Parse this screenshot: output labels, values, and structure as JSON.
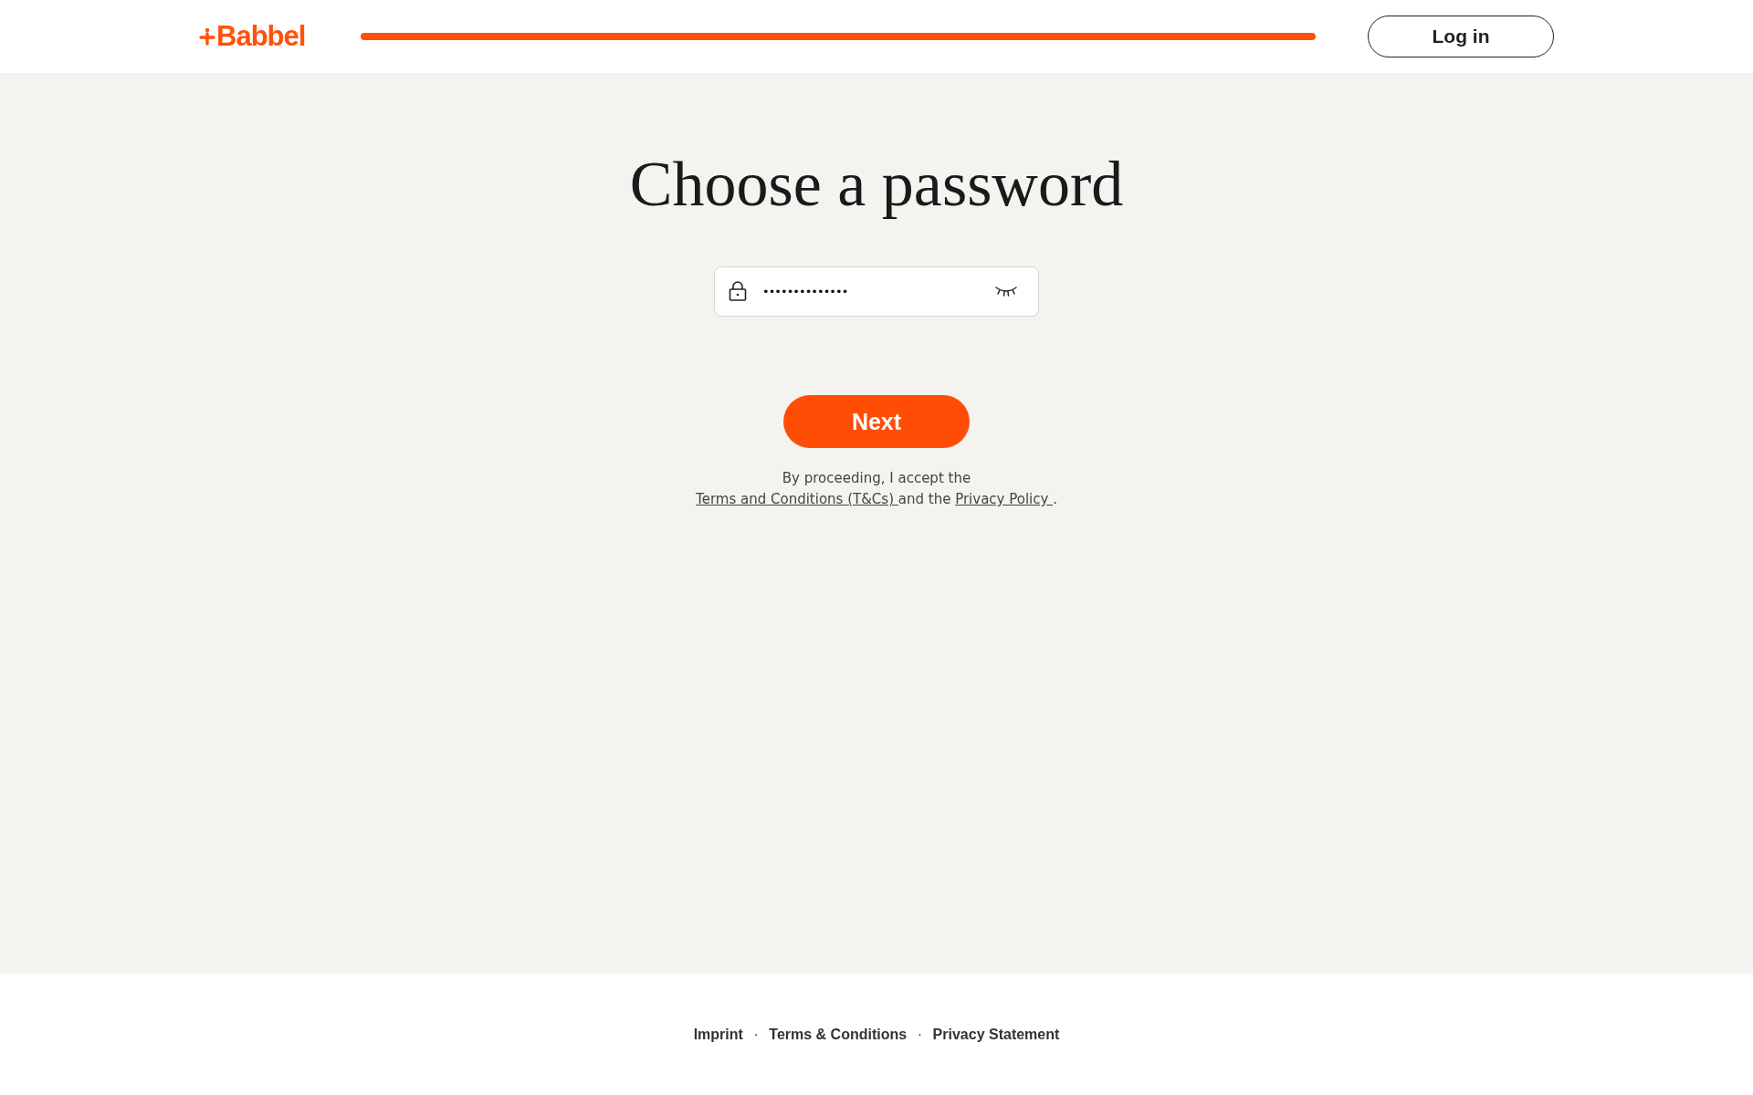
{
  "header": {
    "logo": "Babbel",
    "login_button": "Log in"
  },
  "title": "Choose a password",
  "password_field": {
    "value": "••••••••••••••",
    "visible": false
  },
  "next_button": "Next",
  "consent": [
    {
      "kind": "text",
      "text": "By proceeding, I accept the "
    },
    {
      "kind": "link",
      "text": "Terms and Conditions (T&Cs) "
    },
    {
      "kind": "text",
      "text": "and the "
    },
    {
      "kind": "link",
      "text": "Privacy Policy "
    },
    {
      "kind": "text",
      "text": "."
    }
  ],
  "footer": {
    "links": [
      "Imprint",
      "Terms & Conditions",
      "Privacy Statement"
    ],
    "separator": "·"
  }
}
